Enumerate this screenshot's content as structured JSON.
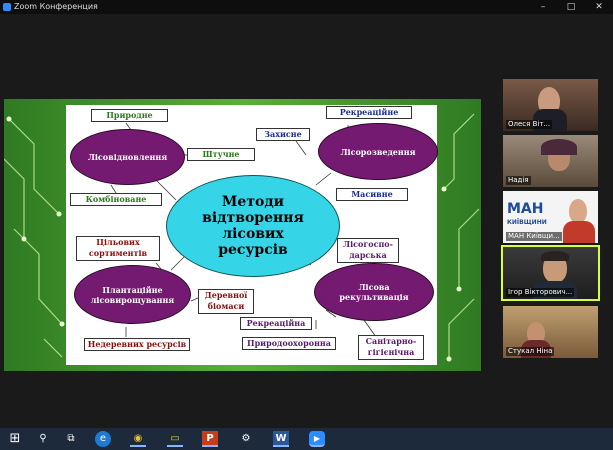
{
  "window": {
    "title": "Zoom Конференция",
    "minimize_label": "–",
    "maximize_label": "□",
    "close_label": "✕"
  },
  "slide": {
    "center_title": "Методи відтворення лісових ресурсів",
    "ovals": {
      "lisovidnovlennia": "Лісовідновлення",
      "lisorozvedennia": "Лісорозведення",
      "plantatsiine": "Плантаційне лісовирощування",
      "lisova_rekultyvatsiia": "Лісова рекультивація"
    },
    "boxes": {
      "pryrodne": "Природне",
      "shtuchne": "Штучне",
      "kombinovane": "Комбіноване",
      "rekreatsiine_top": "Рекреаційне",
      "zakhysne": "Захисне",
      "masyvne": "Масивне",
      "tsilovykh": "Цільових сортиментів",
      "derevnoi": "Деревної біомаси",
      "nederevnykh": "Недеревних ресурсів",
      "lisohosp": "Лісогоспо-дарська",
      "rekreatsiina": "Рекреаційна",
      "pryrodookhoronna": "Природоохоронна",
      "sanitarno": "Санітарно-гігієнічна"
    }
  },
  "participants": [
    {
      "name": "Олеся Віт..."
    },
    {
      "name": "Надія"
    },
    {
      "name": "МАН Київщи..."
    },
    {
      "name": "Ігор Вікторович..."
    },
    {
      "name": "Стукал Ніна"
    }
  ],
  "tile_text": {
    "man": "МАН",
    "kyiv": "КИЇВЩИНИ"
  },
  "taskbar": {
    "icons": [
      "windows-icon",
      "search-icon",
      "task-view-icon",
      "edge-icon",
      "chrome-icon",
      "file-explorer-icon",
      "powerpoint-icon",
      "settings-icon",
      "word-icon",
      "zoom-icon"
    ],
    "glyphs": {
      "windows": "⊞",
      "search": "⚲",
      "taskview": "⧉",
      "edge": "e",
      "chrome": "◉",
      "explorer": "▭",
      "powerpoint": "P",
      "settings": "⚙",
      "word": "W",
      "zoom": "▶"
    }
  }
}
